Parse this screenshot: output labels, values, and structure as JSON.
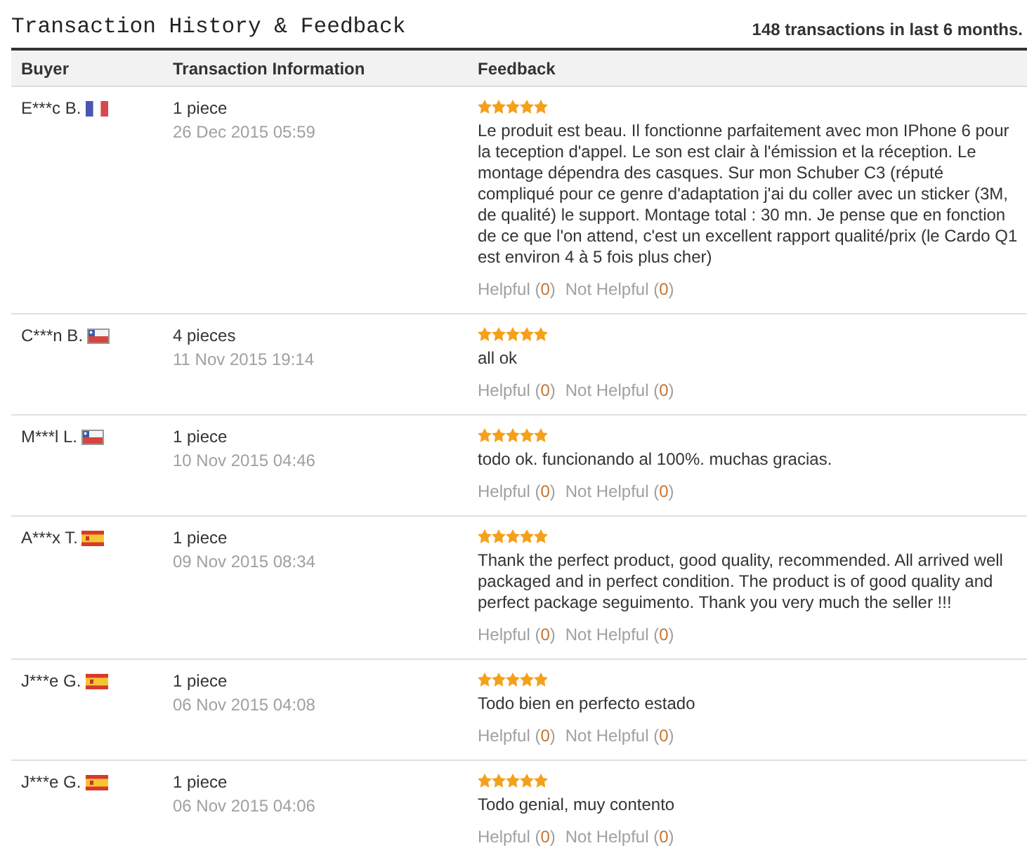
{
  "header": {
    "title": "Transaction History & Feedback",
    "summary": "148 transactions in last 6 months."
  },
  "table": {
    "columns": [
      "Buyer",
      "Transaction Information",
      "Feedback"
    ],
    "rows": [
      {
        "buyer": "E***c B.",
        "flag": {
          "kind": "france"
        },
        "quantity": "1 piece",
        "date": "26 Dec 2015 05:59",
        "stars": 5,
        "feedback": "Le produit est beau. Il fonctionne parfaitement avec mon IPhone 6 pour la teception d'appel. Le son est clair à l'émission et la réception. Le montage dépendra des casques. Sur mon Schuber C3 (réputé compliqué pour ce genre d'adaptation j'ai du coller avec un sticker (3M, de qualité) le support. Montage total : 30 mn. Je pense que en fonction de ce que l'on attend, c'est un excellent rapport qualité/prix (le Cardo Q1 est environ 4 à 5 fois plus cher)",
        "helpful": {
          "before": "Helpful (",
          "count": "0",
          "after": ")"
        },
        "not_helpful": {
          "before": "Not Helpful (",
          "count": "0",
          "after": ")"
        }
      },
      {
        "buyer": "C***n B.",
        "flag": {
          "kind": "chile"
        },
        "quantity": "4 pieces",
        "date": "11 Nov 2015 19:14",
        "stars": 5,
        "feedback": "all ok",
        "helpful": {
          "before": "Helpful (",
          "count": "0",
          "after": ")"
        },
        "not_helpful": {
          "before": "Not Helpful (",
          "count": "0",
          "after": ")"
        }
      },
      {
        "buyer": "M***l L.",
        "flag": {
          "kind": "chile"
        },
        "quantity": "1 piece",
        "date": "10 Nov 2015 04:46",
        "stars": 5,
        "feedback": "todo ok. funcionando al 100%. muchas gracias.",
        "helpful": {
          "before": "Helpful (",
          "count": "0",
          "after": ")"
        },
        "not_helpful": {
          "before": "Not Helpful (",
          "count": "0",
          "after": ")"
        }
      },
      {
        "buyer": "A***x T.",
        "flag": {
          "kind": "spain"
        },
        "quantity": "1 piece",
        "date": "09 Nov 2015 08:34",
        "stars": 5,
        "feedback": "Thank the perfect product, good quality, recommended. All arrived well packaged and in perfect condition. The product is of good quality and perfect package seguimento. Thank you very much the seller !!!",
        "helpful": {
          "before": "Helpful (",
          "count": "0",
          "after": ")"
        },
        "not_helpful": {
          "before": "Not Helpful (",
          "count": "0",
          "after": ")"
        }
      },
      {
        "buyer": "J***e G.",
        "flag": {
          "kind": "spain"
        },
        "quantity": "1 piece",
        "date": "06 Nov 2015 04:08",
        "stars": 5,
        "feedback": "Todo bien en perfecto estado",
        "helpful": {
          "before": "Helpful (",
          "count": "0",
          "after": ")"
        },
        "not_helpful": {
          "before": "Not Helpful (",
          "count": "0",
          "after": ")"
        }
      },
      {
        "buyer": "J***e G.",
        "flag": {
          "kind": "spain"
        },
        "quantity": "1 piece",
        "date": "06 Nov 2015 04:06",
        "stars": 5,
        "feedback": "Todo genial, muy contento",
        "helpful": {
          "before": "Helpful (",
          "count": "0",
          "after": ")"
        },
        "not_helpful": {
          "before": "Not Helpful (",
          "count": "0",
          "after": ")"
        }
      }
    ]
  }
}
